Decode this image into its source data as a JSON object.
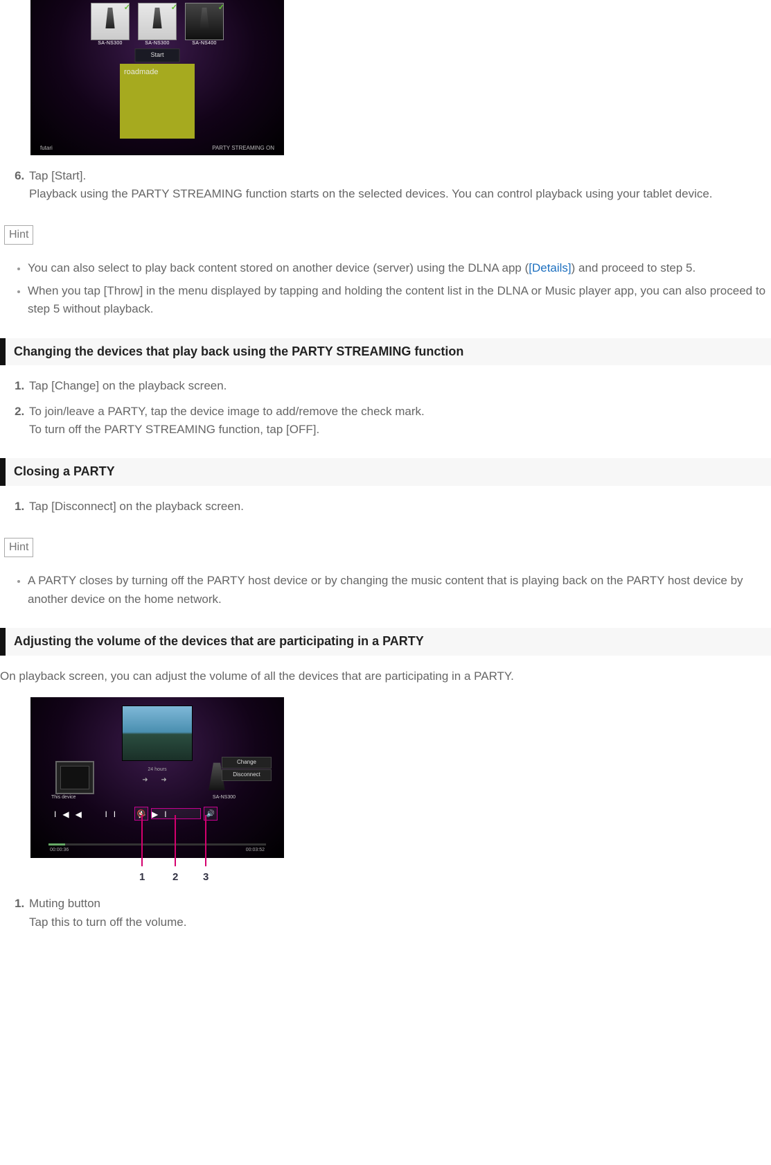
{
  "screenshot1": {
    "devices": [
      {
        "label": "SA-NS300"
      },
      {
        "label": "SA-NS300"
      },
      {
        "label": "SA-NS400"
      }
    ],
    "start": "Start",
    "album": "roadmade",
    "footer_left": "futari",
    "footer_right": "PARTY STREAMING   ON"
  },
  "step6": {
    "num": "6.",
    "lead": "Tap [Start].",
    "body": "Playback using the PARTY STREAMING function starts on the selected devices. You can control playback using your tablet device."
  },
  "hint1": {
    "label": "Hint",
    "items": [
      {
        "pre": "You can also select to play back content stored on another device (server) using the DLNA app (",
        "link": "[Details]",
        "post": ") and proceed to step 5."
      },
      {
        "text": "When you tap [Throw] in the menu displayed by tapping and holding the content list in the DLNA or Music player app, you can also proceed to step 5 without playback."
      }
    ]
  },
  "section_change": {
    "heading": "Changing the devices that play back using the PARTY STREAMING function",
    "steps": [
      {
        "text": "Tap [Change] on the playback screen."
      },
      {
        "text": "To join/leave a PARTY, tap the device image to add/remove the check mark.",
        "text2": "To turn off the PARTY STREAMING function, tap [OFF]."
      }
    ]
  },
  "section_close": {
    "heading": "Closing a PARTY",
    "steps": [
      {
        "text": "Tap [Disconnect] on the playback screen."
      }
    ]
  },
  "hint2": {
    "label": "Hint",
    "items": [
      {
        "text": "A PARTY closes by turning off the PARTY host device or by changing the music content that is playing back on the PARTY host device by another device on the home network."
      }
    ]
  },
  "section_volume": {
    "heading": "Adjusting the volume of the devices that are participating in a PARTY",
    "intro": "On playback screen, you can adjust the volume of all the devices that are participating in a PARTY."
  },
  "screenshot2": {
    "left_label": "This device",
    "mid_label": "24 hours",
    "right_label": "SA-NS300",
    "btn1": "Change",
    "btn2": "Disconnect",
    "time_l": "00:00:36",
    "time_r": "00:03:52",
    "callouts": {
      "n1": "1",
      "n2": "2",
      "n3": "3"
    }
  },
  "legend": {
    "items": [
      {
        "lead": "Muting button",
        "body": "Tap this to turn off the volume."
      }
    ]
  }
}
